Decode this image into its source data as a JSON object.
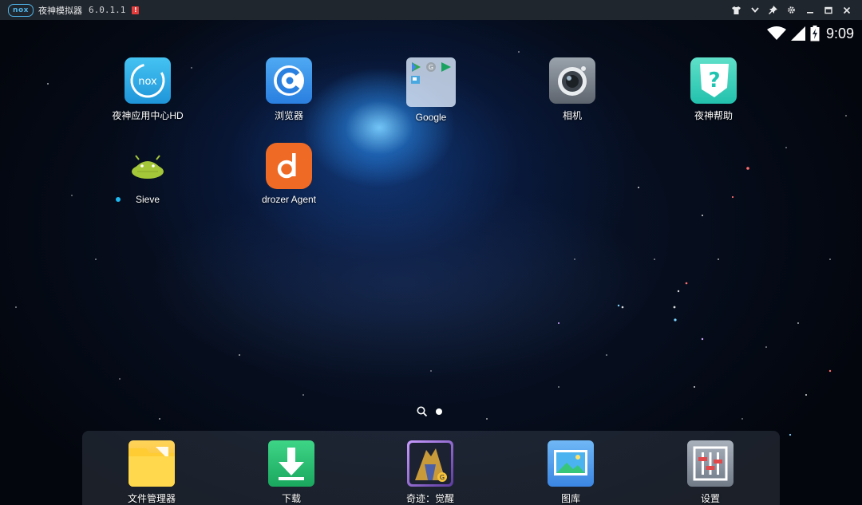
{
  "titlebar": {
    "logo": "nox",
    "title": "夜神模拟器",
    "version": "6.0.1.1",
    "badge": "!",
    "controls": [
      "shirt-icon",
      "chevron-down-icon",
      "pin-icon",
      "gear-icon",
      "minimize-icon",
      "maximize-icon",
      "close-icon"
    ]
  },
  "statusbar": {
    "time": "9:09",
    "icons": [
      "wifi-icon",
      "signal-icon",
      "battery-charging-icon"
    ]
  },
  "home": {
    "apps": [
      {
        "label": "夜神应用中心HD",
        "icon": "nox-app-center-icon"
      },
      {
        "label": "浏览器",
        "icon": "browser-icon"
      },
      {
        "label": "Google",
        "icon": "google-folder-icon"
      },
      {
        "label": "相机",
        "icon": "camera-icon"
      },
      {
        "label": "夜神帮助",
        "icon": "nox-help-icon"
      },
      {
        "label": "Sieve",
        "icon": "android-sieve-icon"
      },
      {
        "label": "drozer Agent",
        "icon": "drozer-icon"
      }
    ]
  },
  "dock": {
    "apps": [
      {
        "label": "文件管理器",
        "icon": "folder-icon"
      },
      {
        "label": "下载",
        "icon": "download-icon"
      },
      {
        "label": "奇迹：觉醒",
        "icon": "game-icon"
      },
      {
        "label": "图库",
        "icon": "gallery-icon"
      },
      {
        "label": "设置",
        "icon": "settings-icon"
      }
    ]
  },
  "colors": {
    "titlebar_bg": "#20262d",
    "accent": "#4fb3e8",
    "badge_red": "#e43b3b",
    "dock_bg": "rgba(90,100,115,0.28)"
  }
}
